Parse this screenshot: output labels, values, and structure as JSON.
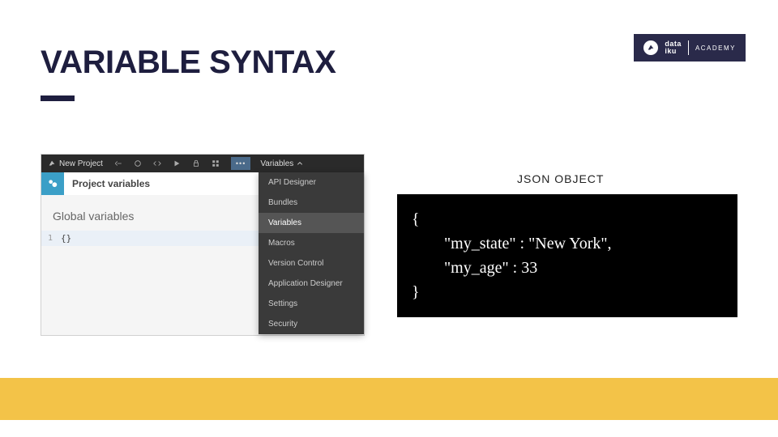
{
  "slide": {
    "title": "VARIABLE SYNTAX"
  },
  "logo": {
    "brand_line1": "data",
    "brand_line2": "iku",
    "academy": "ACADEMY"
  },
  "app": {
    "project_name": "New Project",
    "toolbar_menu_label": "Variables",
    "project_vars_title": "Project variables",
    "global_vars_title": "Global variables",
    "line_number": "1",
    "code": "{}",
    "dropdown": [
      "API Designer",
      "Bundles",
      "Variables",
      "Macros",
      "Version Control",
      "Application Designer",
      "Settings",
      "Security"
    ]
  },
  "json_panel": {
    "label": "JSON OBJECT",
    "content": "{\n        \"my_state\" : \"New York\",\n        \"my_age\" : 33\n}"
  }
}
